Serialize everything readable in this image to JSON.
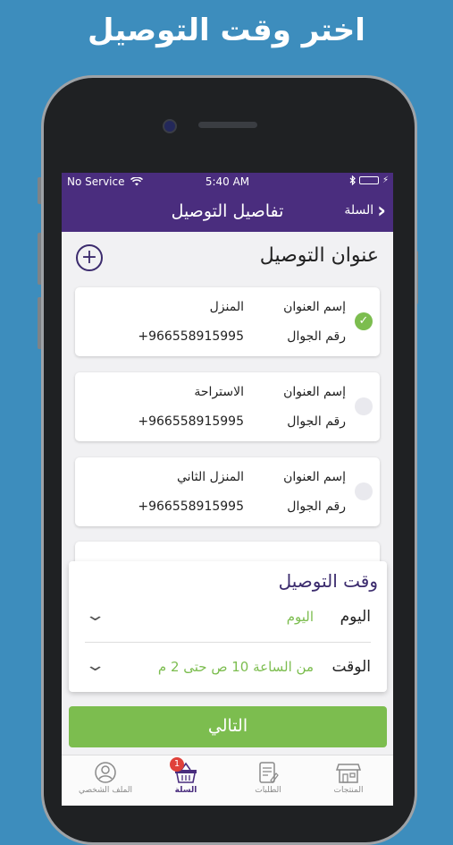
{
  "headline": "اختر وقت التوصيل",
  "status_bar": {
    "carrier": "No Service",
    "time": "5:40 AM",
    "battery_level": 1.0
  },
  "navbar": {
    "title": "تفاصيل التوصيل",
    "back_label": "السلة"
  },
  "addresses": {
    "section_title": "عنوان التوصيل",
    "name_label": "إسم العنوان",
    "phone_label": "رقم الجوال",
    "items": [
      {
        "name": "المنزل",
        "phone": "+966558915995",
        "selected": true
      },
      {
        "name": "الاستراحة",
        "phone": "+966558915995",
        "selected": false
      },
      {
        "name": "المنزل الثاني",
        "phone": "+966558915995",
        "selected": false
      }
    ]
  },
  "delivery_time": {
    "title": "وقت التوصيل",
    "day_label": "اليوم",
    "day_value": "اليوم",
    "time_label": "الوقت",
    "time_value": "من الساعة 10 ص حتى 2 م"
  },
  "next_button": "التالي",
  "tabs": [
    {
      "label": "المنتجات",
      "icon": "store-icon",
      "active": false
    },
    {
      "label": "الطلبات",
      "icon": "orders-icon",
      "active": false
    },
    {
      "label": "السلة",
      "icon": "basket-icon",
      "active": true,
      "badge": "1"
    },
    {
      "label": "الملف الشخصي",
      "icon": "profile-icon",
      "active": false
    }
  ],
  "colors": {
    "background": "#3d8dbd",
    "brand_purple": "#4a2d7e",
    "accent_green": "#7cbd4f"
  }
}
